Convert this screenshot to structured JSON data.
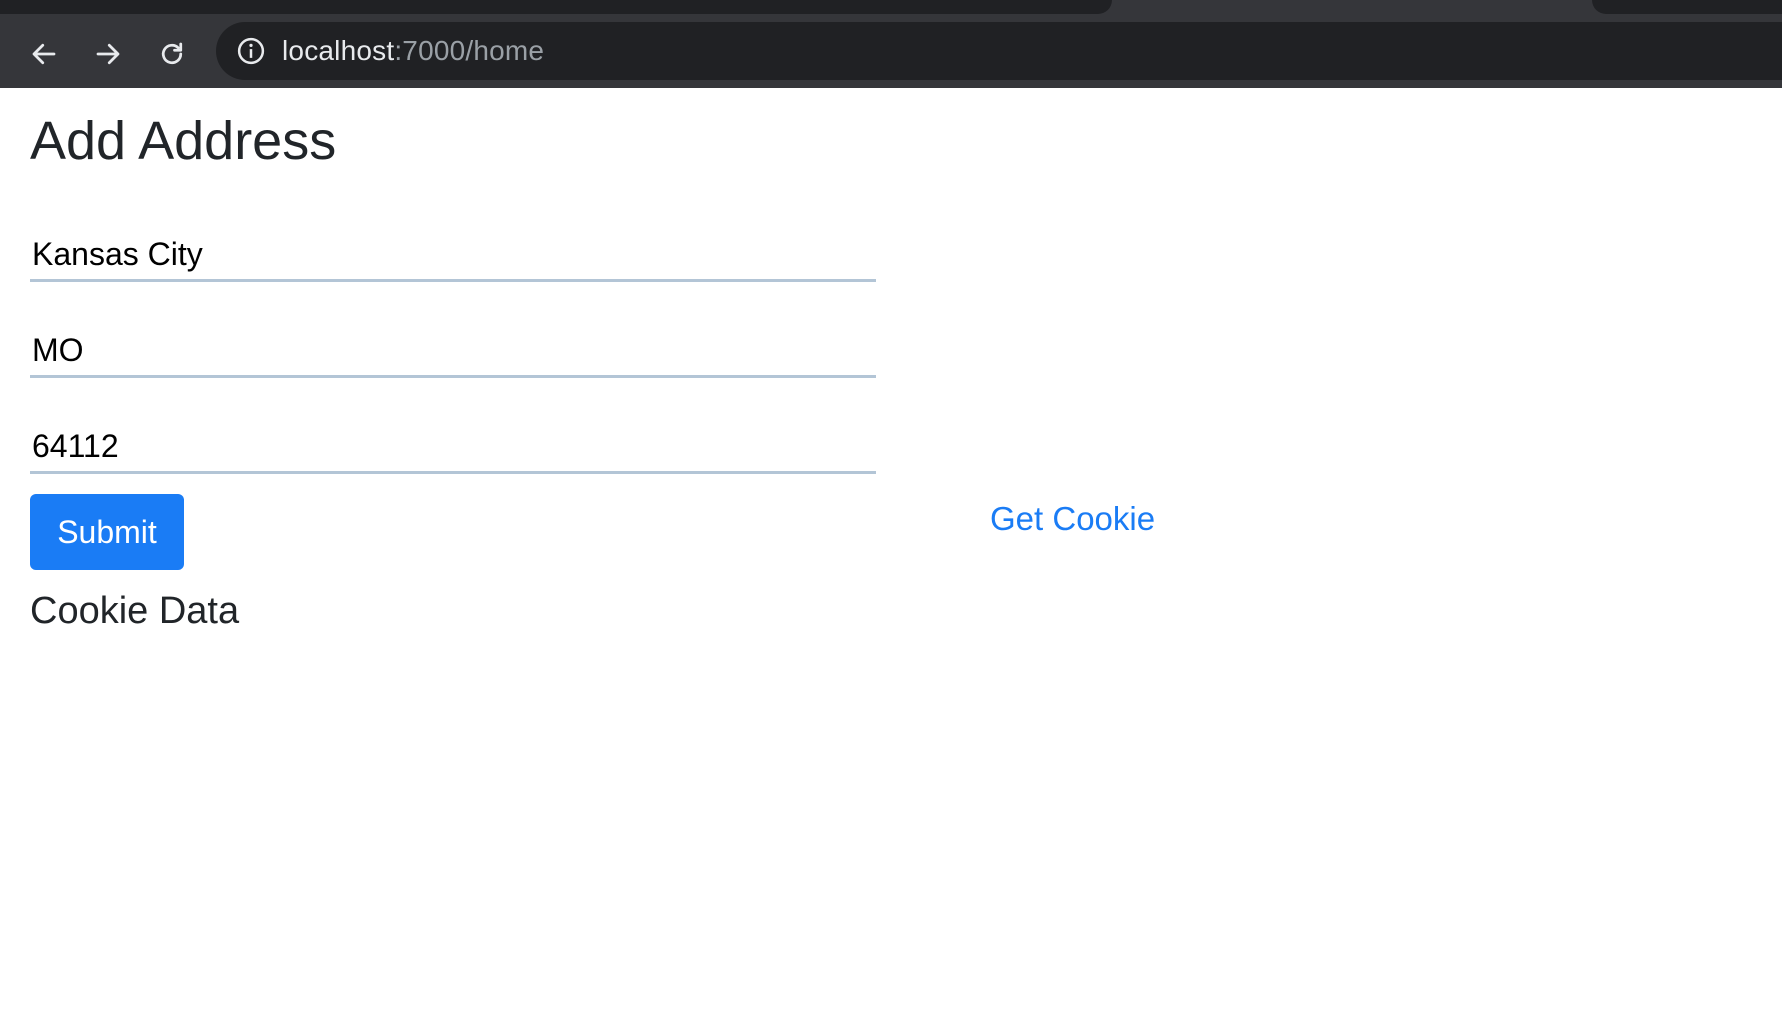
{
  "browser": {
    "url_host": "localhost",
    "url_rest": ":7000/home"
  },
  "page": {
    "title": "Add Address",
    "fields": {
      "city": "Kansas City",
      "state": "MO",
      "zip": "64112"
    },
    "submit_label": "Submit",
    "get_cookie_label": "Get Cookie",
    "cookie_section_title": "Cookie Data"
  },
  "colors": {
    "accent": "#1a7cf5",
    "field_underline": "#b3c5d6",
    "chrome_bg": "#35363a",
    "omnibox_bg": "#202124"
  },
  "icons": {
    "back": "back-arrow-icon",
    "forward": "forward-arrow-icon",
    "reload": "reload-icon",
    "info": "info-icon"
  }
}
